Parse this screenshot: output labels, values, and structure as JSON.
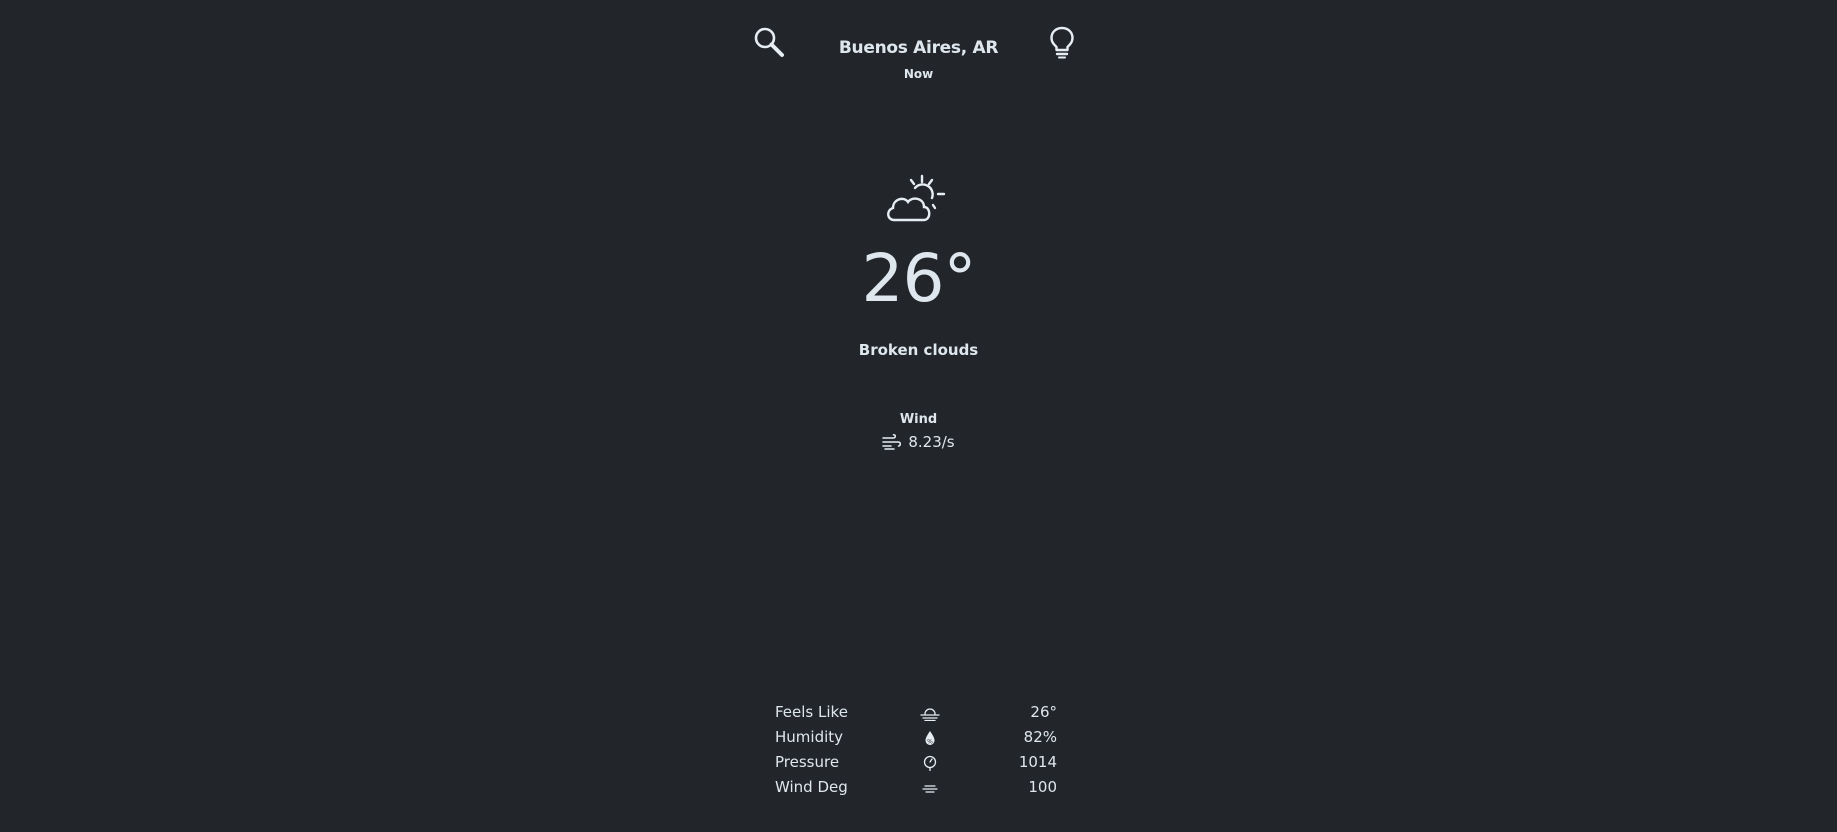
{
  "header": {
    "city": "Buenos Aires, AR",
    "time": "Now"
  },
  "icons": {
    "search": "search-icon",
    "theme": "lightbulb-icon",
    "weather": "partly-cloudy-icon",
    "wind": "wind-icon"
  },
  "current": {
    "temperature": "26°",
    "description": "Broken clouds"
  },
  "wind": {
    "label": "Wind",
    "value": "8.23/s"
  },
  "details": [
    {
      "label": "Feels Like",
      "icon": "sunset-icon",
      "value": "26°"
    },
    {
      "label": "Humidity",
      "icon": "humidity-drop-icon",
      "value": "82%"
    },
    {
      "label": "Pressure",
      "icon": "pressure-icon",
      "value": "1014"
    },
    {
      "label": "Wind Deg",
      "icon": "wind-direction-icon",
      "value": "100"
    }
  ],
  "colors": {
    "background": "#22262b",
    "text": "#dfe7ee"
  }
}
